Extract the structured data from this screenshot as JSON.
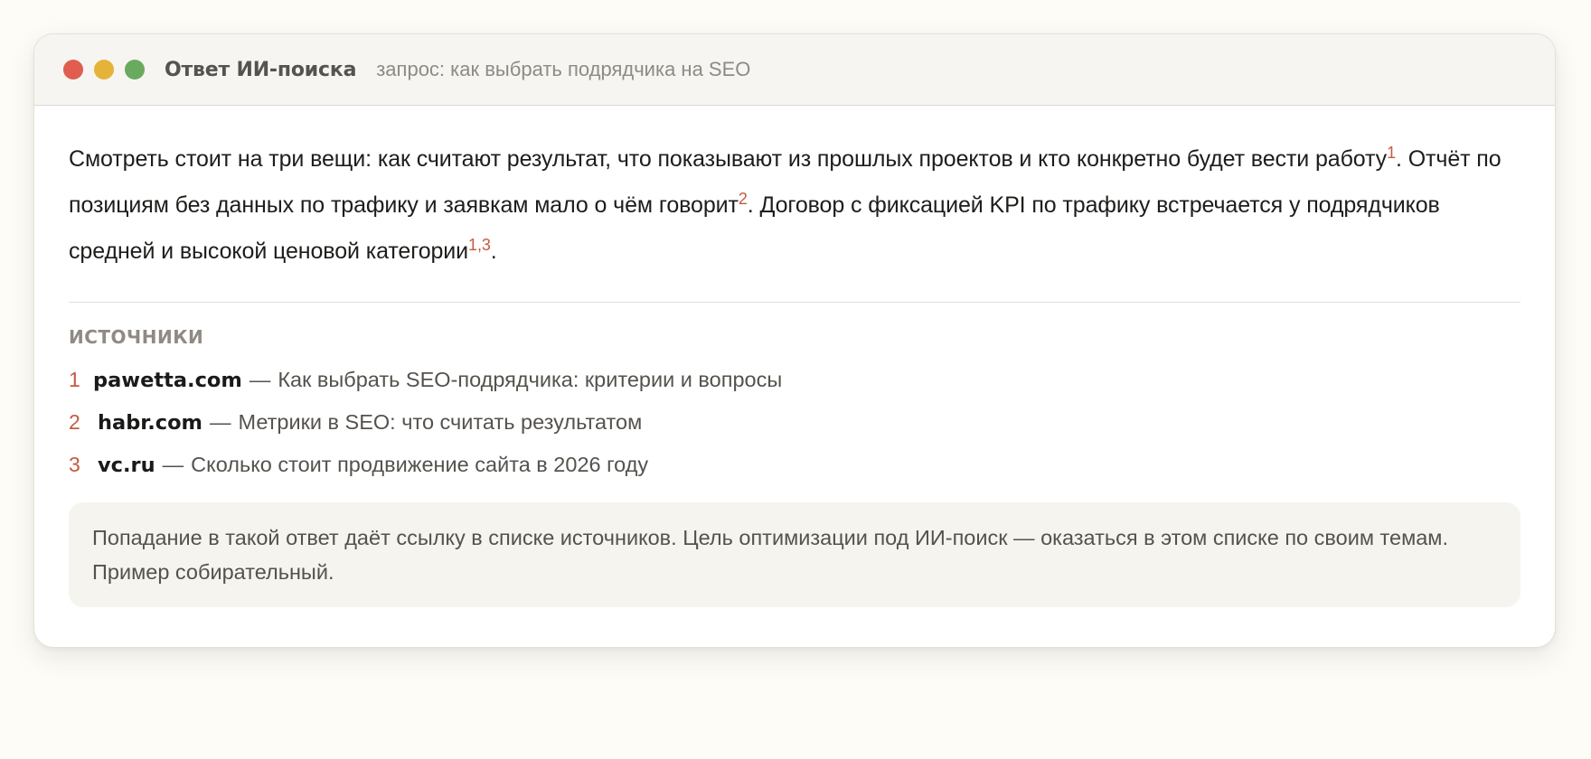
{
  "window": {
    "title": "Ответ ИИ-поиска",
    "query": "запрос: как выбрать подрядчика на SEO"
  },
  "answer": {
    "sentence1": "Смотреть стоит на три вещи: как считают результат, что показывают из прошлых проектов и кто конкретно будет вести работу",
    "cite1": "1",
    "sentence2": ". Отчёт по позициям без данных по трафику и заявкам мало о чём говорит",
    "cite2": "2",
    "sentence3": ". Договор с фиксацией KPI по трафику встречается у подрядчиков средней и высокой ценовой категории",
    "cite3": "1,3",
    "end": "."
  },
  "sources": {
    "heading": "ИСТОЧНИКИ",
    "items": [
      {
        "num": "1",
        "domain": "pawetta.com",
        "dash": "—",
        "title": "Как выбрать SEO-подрядчика: критерии и вопросы"
      },
      {
        "num": "2",
        "domain": "habr.com",
        "dash": "—",
        "title": "Метрики в SEO: что считать результатом"
      },
      {
        "num": "3",
        "domain": "vc.ru",
        "dash": "—",
        "title": "Сколько стоит продвижение сайта в 2026 году"
      }
    ]
  },
  "note": "Попадание в такой ответ даёт ссылку в списке источников. Цель оптимизации под ИИ-поиск — оказаться в этом списке по своим темам. Пример собирательный.",
  "colors": {
    "accent": "#c55a40",
    "close": "#e05d50",
    "minimize": "#e5b33a",
    "maximize": "#6aaa5f"
  }
}
